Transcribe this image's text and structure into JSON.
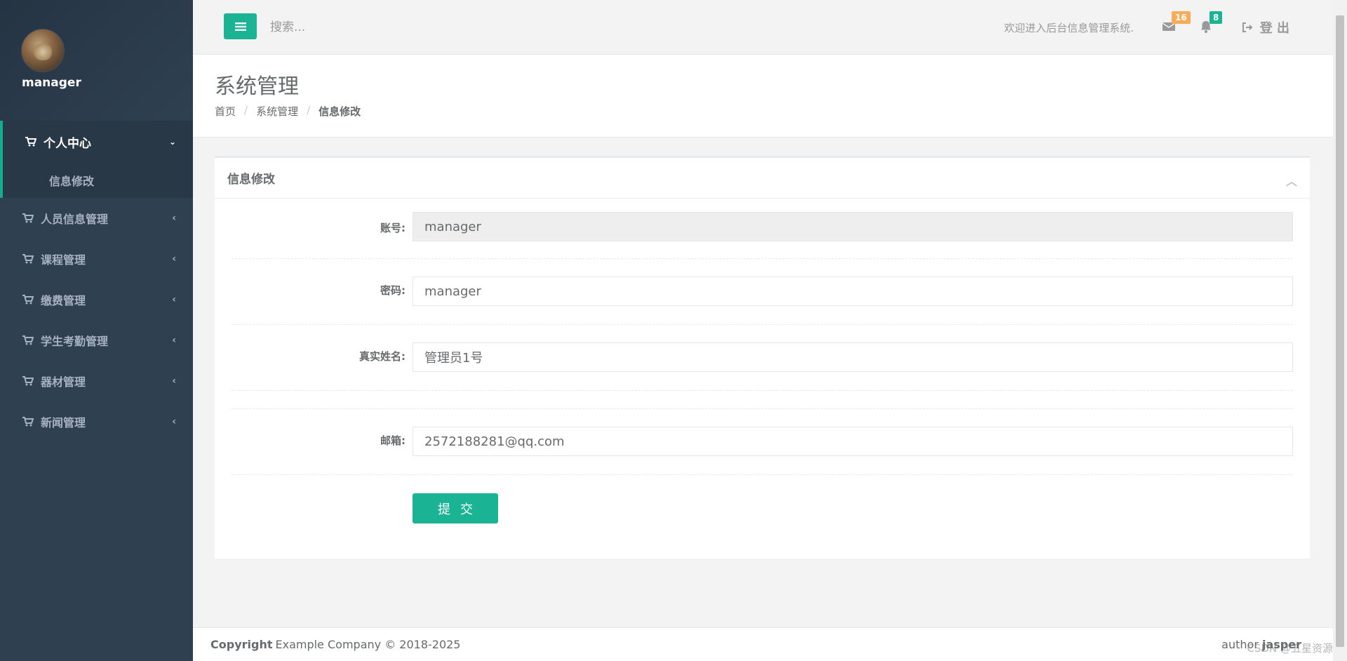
{
  "colors": {
    "sidebar_bg": "#2f4050",
    "accent": "#1ab394",
    "badge_warning": "#f8ac59"
  },
  "sidebar": {
    "username": "manager",
    "active_section": {
      "label": "个人中心",
      "icon": "cart-icon",
      "sub_item": "信息修改"
    },
    "items": [
      {
        "label": "人员信息管理",
        "icon": "cart-icon"
      },
      {
        "label": "课程管理",
        "icon": "cart-icon"
      },
      {
        "label": "缴费管理",
        "icon": "cart-icon"
      },
      {
        "label": "学生考勤管理",
        "icon": "cart-icon"
      },
      {
        "label": "器材管理",
        "icon": "cart-icon"
      },
      {
        "label": "新闻管理",
        "icon": "cart-icon"
      }
    ]
  },
  "topbar": {
    "search_placeholder": "搜索...",
    "welcome": "欢迎进入后台信息管理系统.",
    "messages_count": "16",
    "notifications_count": "8",
    "logout": "登 出"
  },
  "page": {
    "title": "系统管理",
    "breadcrumb": [
      "首页",
      "系统管理",
      "信息修改"
    ]
  },
  "form": {
    "title": "信息修改",
    "account_label": "账号:",
    "account_value": "manager",
    "password_label": "密码:",
    "password_value": "manager",
    "realname_label": "真实姓名:",
    "realname_value": "管理员1号",
    "email_label": "邮箱:",
    "email_value": "2572188281@qq.com",
    "submit": "提交"
  },
  "footer": {
    "copyright_label": "Copyright",
    "copyright_text": "Example Company © 2018-2025",
    "author_label": "author",
    "author_name": "jasper"
  },
  "watermark": "CSDN @五星资源"
}
